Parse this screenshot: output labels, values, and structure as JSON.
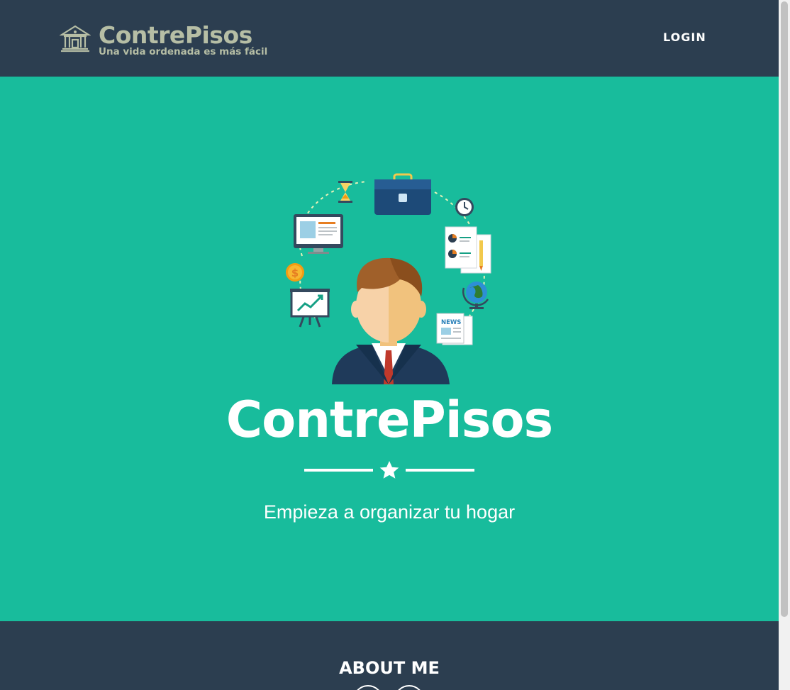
{
  "navbar": {
    "brand_name": "ContrePisos",
    "brand_tagline": "Una vida ordenada es más fácil",
    "login_label": "LOGIN",
    "brand_icon": "house-icon"
  },
  "hero": {
    "illustration": "businessman-illustration",
    "badge_text": "NEWS",
    "title": "ContrePisos",
    "divider_icon": "star-icon",
    "subtitle": "Empieza a organizar tu hogar"
  },
  "about": {
    "title": "ABOUT ME"
  },
  "colors": {
    "navbar_bg": "#2c3e50",
    "masthead_bg": "#18bc9c",
    "brand_text": "#b6bea5",
    "white": "#ffffff"
  }
}
